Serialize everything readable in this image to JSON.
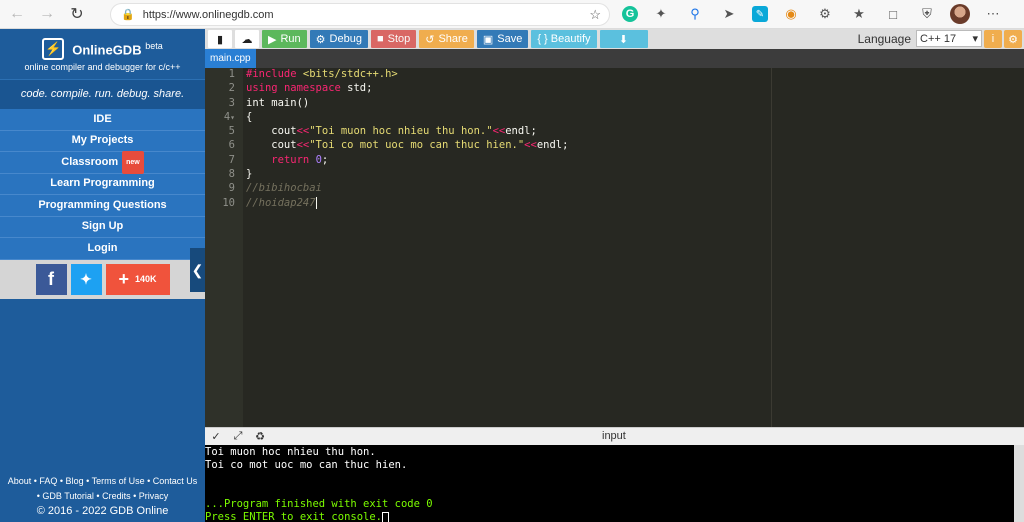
{
  "browser": {
    "url": "https://www.onlinegdb.com"
  },
  "sidebar": {
    "brand_name": "OnlineGDB",
    "brand_sup": "beta",
    "brand_sub": "online compiler and debugger for c/c++",
    "tagline": "code. compile. run. debug. share.",
    "items": [
      {
        "label": "IDE"
      },
      {
        "label": "My Projects"
      },
      {
        "label": "Classroom",
        "badge": "new"
      },
      {
        "label": "Learn Programming"
      },
      {
        "label": "Programming Questions"
      },
      {
        "label": "Sign Up"
      },
      {
        "label": "Login"
      }
    ],
    "social": {
      "plus_count": "140K"
    },
    "footer": {
      "line1": "About • FAQ • Blog • Terms of Use • Contact Us",
      "line2": "• GDB Tutorial • Credits • Privacy",
      "copyright": "© 2016 - 2022 GDB Online"
    }
  },
  "toolbar": {
    "run": "Run",
    "debug": "Debug",
    "stop": "Stop",
    "share": "Share",
    "save": "Save",
    "beautify": "{ } Beautify",
    "language_label": "Language",
    "language_value": "C++ 17"
  },
  "editor": {
    "file_tab": "main.cpp",
    "line_numbers": [
      "1",
      "2",
      "3",
      "4",
      "5",
      "6",
      "7",
      "8",
      "9",
      "10"
    ]
  },
  "console": {
    "title": "input",
    "lines": [
      "Toi muon hoc nhieu thu hon.",
      "Toi co mot uoc mo can thuc hien.",
      "",
      "",
      "...Program finished with exit code 0",
      "Press ENTER to exit console."
    ]
  },
  "colors": {
    "sidebar_bg": "#1e5c9b",
    "run": "#5cb85c",
    "debug": "#337ab7",
    "stop": "#d9534f",
    "share": "#f0ad4e",
    "editor_bg": "#272822"
  }
}
